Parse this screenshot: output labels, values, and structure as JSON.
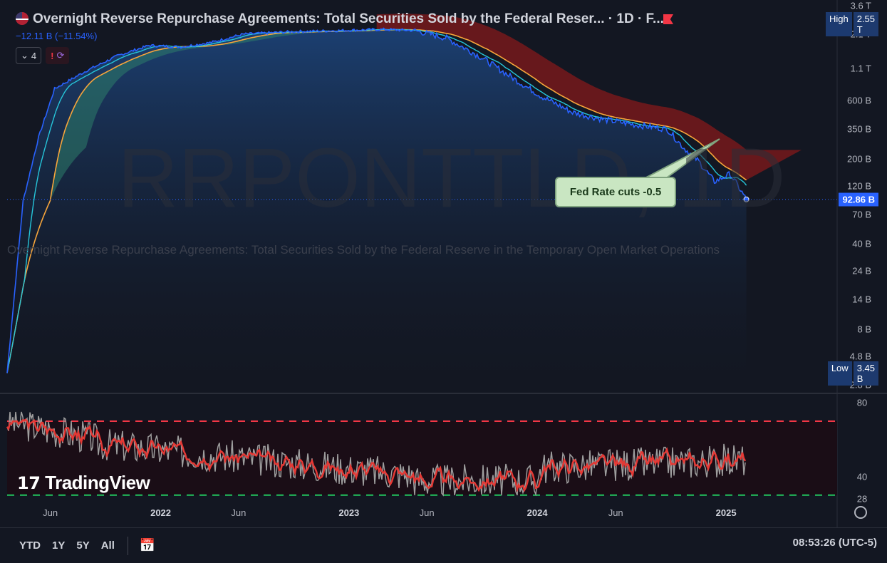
{
  "header": {
    "title": "Overnight Reverse Repurchase Agreements: Total Securities Sold by the Federal Reser... · 1D · F...",
    "change": "−12.11 B (−11.54%)",
    "indicator_count": "4"
  },
  "watermark": {
    "symbol": "RRPONTTLD, 1D",
    "description": "Overnight Reverse Repurchase Agreements: Total Securities Sold by the Federal Reserve in the Temporary Open Market Operations"
  },
  "annotation": {
    "text": "Fed Rate cuts -0.5"
  },
  "price_axis": {
    "labels": [
      "3.6 T",
      "2.1 T",
      "1.1 T",
      "600 B",
      "350 B",
      "200 B",
      "120 B",
      "70 B",
      "40 B",
      "24 B",
      "14 B",
      "8 B",
      "4.8 B",
      "2.8 B"
    ],
    "high_label": "High",
    "high_value": "2.55 T",
    "low_label": "Low",
    "low_value": "3.45 B",
    "last_value": "92.86 B"
  },
  "oscillator_axis": {
    "labels": [
      "80",
      "40",
      "28"
    ]
  },
  "time_axis": {
    "labels": [
      {
        "text": "Jun",
        "bold": false
      },
      {
        "text": "2022",
        "bold": true
      },
      {
        "text": "Jun",
        "bold": false
      },
      {
        "text": "2023",
        "bold": true
      },
      {
        "text": "Jun",
        "bold": false
      },
      {
        "text": "2024",
        "bold": true
      },
      {
        "text": "Jun",
        "bold": false
      },
      {
        "text": "2025",
        "bold": true
      }
    ]
  },
  "brand": {
    "logo_text": "TradingView"
  },
  "bottom_bar": {
    "ranges": [
      "YTD",
      "1Y",
      "5Y",
      "All"
    ],
    "clock": "08:53:26 (UTC-5)"
  },
  "colors": {
    "background": "#131722",
    "price_line": "#2962ff",
    "fast_ma": "#26c6da",
    "slow_ma": "#f7a53b",
    "cloud_bull": "#2e7d6a",
    "cloud_bear": "#8b1a1a",
    "rsi": "#e53935",
    "rsi_raw": "#9e9e9e",
    "upper_band": "#f23645",
    "lower_band": "#22c55e"
  },
  "chart_data": {
    "type": "line",
    "title": "Overnight Reverse Repurchase Agreements: Total Securities Sold by the Federal Reserve in the Temporary Open Market Operations",
    "y_scale": "log",
    "ylim_billions": [
      2.8,
      3600
    ],
    "series": [
      {
        "values_billions": [
          {
            "x": "2021-03",
            "y": 3.5
          },
          {
            "x": "2021-04",
            "y": 90
          },
          {
            "x": "2021-05",
            "y": 300
          },
          {
            "x": "2021-06",
            "y": 750
          },
          {
            "x": "2021-08",
            "y": 1050
          },
          {
            "x": "2021-10",
            "y": 1400
          },
          {
            "x": "2021-12",
            "y": 1700
          },
          {
            "x": "2022-02",
            "y": 1650
          },
          {
            "x": "2022-04",
            "y": 1800
          },
          {
            "x": "2022-06",
            "y": 2100
          },
          {
            "x": "2022-09",
            "y": 2200
          },
          {
            "x": "2022-12",
            "y": 2250
          },
          {
            "x": "2023-03",
            "y": 2300
          },
          {
            "x": "2023-05",
            "y": 2250
          },
          {
            "x": "2023-07",
            "y": 1950
          },
          {
            "x": "2023-09",
            "y": 1400
          },
          {
            "x": "2023-11",
            "y": 950
          },
          {
            "x": "2024-01",
            "y": 650
          },
          {
            "x": "2024-03",
            "y": 480
          },
          {
            "x": "2024-05",
            "y": 420
          },
          {
            "x": "2024-07",
            "y": 380
          },
          {
            "x": "2024-09",
            "y": 350
          },
          {
            "x": "2024-10",
            "y": 250
          },
          {
            "x": "2024-11",
            "y": 190
          },
          {
            "x": "2024-12",
            "y": 130
          },
          {
            "x": "2025-01",
            "y": 150
          },
          {
            "x": "2025-02",
            "y": 92.86
          }
        ]
      }
    ],
    "oscillator": {
      "ylim": [
        28,
        80
      ],
      "upper_band": 70,
      "lower_band": 30,
      "ticks": [
        80,
        40,
        28
      ]
    },
    "grid": false,
    "high": "2.55 T",
    "low": "3.45 B",
    "last": "92.86 B"
  }
}
